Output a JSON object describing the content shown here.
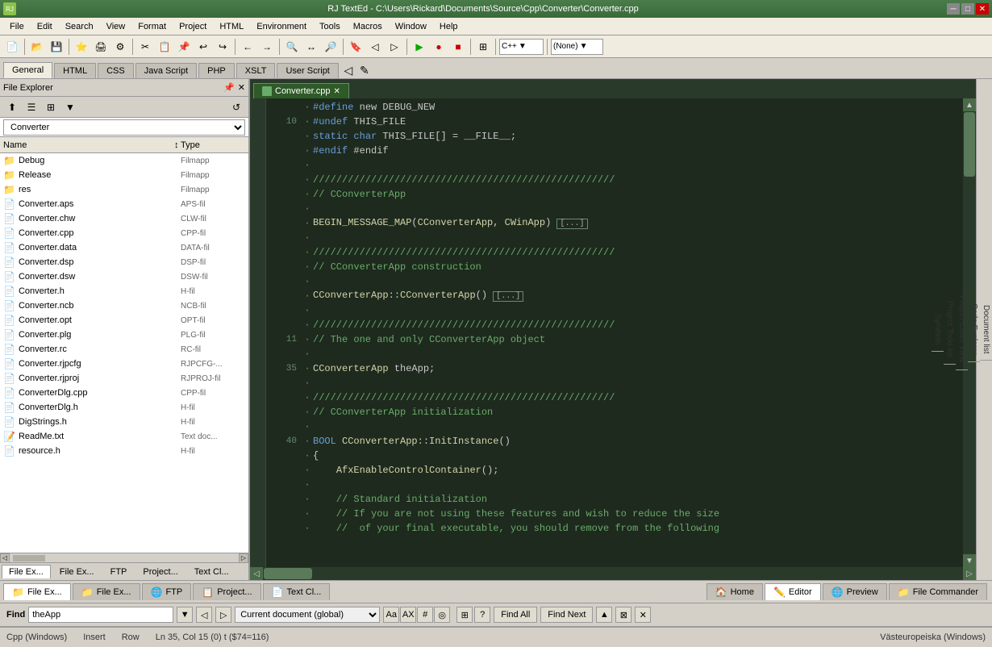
{
  "titlebar": {
    "title": "RJ TextEd - C:\\Users\\Rickard\\Documents\\Source\\Cpp\\Converter\\Converter.cpp",
    "app_icon": "RJ"
  },
  "menubar": {
    "items": [
      "File",
      "Edit",
      "Search",
      "View",
      "Format",
      "Project",
      "HTML",
      "Environment",
      "Tools",
      "Macros",
      "Window",
      "Help"
    ]
  },
  "tabs_top": {
    "items": [
      "General",
      "HTML",
      "CSS",
      "Java Script",
      "PHP",
      "XSLT",
      "User Script"
    ],
    "active": "General"
  },
  "file_explorer": {
    "title": "File Explorer",
    "folder": "Converter",
    "columns": {
      "name": "Name",
      "type": "Type"
    },
    "items": [
      {
        "name": "Debug",
        "type": "Filmapp",
        "icon": "folder"
      },
      {
        "name": "Release",
        "type": "Filmapp",
        "icon": "folder"
      },
      {
        "name": "res",
        "type": "Filmapp",
        "icon": "folder"
      },
      {
        "name": "Converter.aps",
        "type": "APS-fil",
        "icon": "file"
      },
      {
        "name": "Converter.chw",
        "type": "CLW-fil",
        "icon": "file"
      },
      {
        "name": "Converter.cpp",
        "type": "CPP-fil",
        "icon": "cpp"
      },
      {
        "name": "Converter.data",
        "type": "DATA-fil",
        "icon": "file"
      },
      {
        "name": "Converter.dsp",
        "type": "DSP-fil",
        "icon": "file"
      },
      {
        "name": "Converter.dsw",
        "type": "DSW-fil",
        "icon": "file"
      },
      {
        "name": "Converter.h",
        "type": "H-fil",
        "icon": "file"
      },
      {
        "name": "Converter.ncb",
        "type": "NCB-fil",
        "icon": "file"
      },
      {
        "name": "Converter.opt",
        "type": "OPT-fil",
        "icon": "file"
      },
      {
        "name": "Converter.plg",
        "type": "PLG-fil",
        "icon": "file"
      },
      {
        "name": "Converter.rc",
        "type": "RC-fil",
        "icon": "file"
      },
      {
        "name": "Converter.rjpcfg",
        "type": "RJPCFG-...",
        "icon": "file"
      },
      {
        "name": "Converter.rjproj",
        "type": "RJPROJ-fil",
        "icon": "file"
      },
      {
        "name": "ConverterDlg.cpp",
        "type": "CPP-fil",
        "icon": "cpp"
      },
      {
        "name": "ConverterDlg.h",
        "type": "H-fil",
        "icon": "file"
      },
      {
        "name": "DigStrings.h",
        "type": "H-fil",
        "icon": "file"
      },
      {
        "name": "ReadMe.txt",
        "type": "Text doc...",
        "icon": "txt"
      },
      {
        "name": "resource.h",
        "type": "H-fil",
        "icon": "file"
      }
    ]
  },
  "editor": {
    "tab_name": "Converter.cpp",
    "code_lines": [
      {
        "num": "",
        "dot": "·",
        "text": "#define new DEBUG_NEW",
        "type": "preprocessor"
      },
      {
        "num": "10",
        "dot": "·",
        "text": "#undef THIS_FILE",
        "type": "preprocessor"
      },
      {
        "num": "",
        "dot": "·",
        "text": "static char THIS_FILE[] = __FILE__;",
        "type": "code"
      },
      {
        "num": "",
        "dot": "·",
        "text": "#endif",
        "type": "preprocessor"
      },
      {
        "num": "",
        "dot": "·",
        "text": "",
        "type": "empty"
      },
      {
        "num": "",
        "dot": "·",
        "text": "////////////////////////////////////////////////////",
        "type": "comment_line"
      },
      {
        "num": "",
        "dot": "·",
        "text": "// CConverterApp",
        "type": "comment"
      },
      {
        "num": "",
        "dot": "·",
        "text": "",
        "type": "empty"
      },
      {
        "num": "",
        "dot": "·",
        "text": "BEGIN_MESSAGE_MAP(CConverterApp, CWinApp)",
        "type": "code",
        "fold": "[...]"
      },
      {
        "num": "",
        "dot": "·",
        "text": "",
        "type": "empty"
      },
      {
        "num": "",
        "dot": "·",
        "text": "////////////////////////////////////////////////////",
        "type": "comment_line"
      },
      {
        "num": "",
        "dot": "·",
        "text": "// CConverterApp construction",
        "type": "comment"
      },
      {
        "num": "",
        "dot": "·",
        "text": "",
        "type": "empty"
      },
      {
        "num": "",
        "dot": "·",
        "text": "CConverterApp::CConverterApp()",
        "type": "code",
        "fold": "[...]"
      },
      {
        "num": "",
        "dot": "·",
        "text": "",
        "type": "empty"
      },
      {
        "num": "",
        "dot": "·",
        "text": "////////////////////////////////////////////////////",
        "type": "comment_line"
      },
      {
        "num": "11",
        "dot": "·",
        "text": "// The one and only CConverterApp object",
        "type": "comment"
      },
      {
        "num": "",
        "dot": "·",
        "text": "",
        "type": "empty"
      },
      {
        "num": "35",
        "dot": "·",
        "text": "CConverterApp theApp;",
        "type": "code",
        "highlight": true
      },
      {
        "num": "",
        "dot": "·",
        "text": "",
        "type": "empty"
      },
      {
        "num": "",
        "dot": "·",
        "text": "////////////////////////////////////////////////////",
        "type": "comment_line"
      },
      {
        "num": "",
        "dot": "·",
        "text": "// CConverterApp initialization",
        "type": "comment"
      },
      {
        "num": "",
        "dot": "·",
        "text": "",
        "type": "empty"
      },
      {
        "num": "40",
        "dot": "·",
        "text": "BOOL CConverterApp::InitInstance()",
        "type": "code"
      },
      {
        "num": "",
        "dot": "·",
        "text": "{",
        "type": "code"
      },
      {
        "num": "",
        "dot": "·",
        "text": "    AfxEnableControlContainer();",
        "type": "code"
      },
      {
        "num": "",
        "dot": "·",
        "text": "",
        "type": "empty"
      },
      {
        "num": "",
        "dot": "·",
        "text": "    // Standard initialization",
        "type": "comment"
      },
      {
        "num": "",
        "dot": "·",
        "text": "    // If you are not using these features and wish to reduce the size",
        "type": "comment"
      },
      {
        "num": "",
        "dot": "·",
        "text": "    //  of your final executable, you should remove from the following",
        "type": "comment"
      }
    ]
  },
  "right_sidebar": {
    "items": [
      "Document list",
      "Code Explorer",
      "Project Class View",
      "Project Todo list",
      "Symbols"
    ]
  },
  "bottom_tabs": {
    "items": [
      {
        "label": "File Ex...",
        "icon": "📁"
      },
      {
        "label": "File Ex...",
        "icon": "📁"
      },
      {
        "label": "FTP",
        "icon": "🌐"
      },
      {
        "label": "Project...",
        "icon": "📋"
      },
      {
        "label": "Text Cl...",
        "icon": "📄"
      }
    ],
    "active": 0
  },
  "bottom_tabs2": {
    "items": [
      {
        "label": "Home",
        "icon": "🏠"
      },
      {
        "label": "Editor",
        "icon": "✏️"
      },
      {
        "label": "Preview",
        "icon": "🌐"
      },
      {
        "label": "File Commander",
        "icon": "📁"
      }
    ],
    "active": 1
  },
  "find_bar": {
    "label": "Find",
    "input_value": "theApp",
    "scope": "Current document (global)",
    "buttons": [
      "Find All",
      "Find Next"
    ],
    "options": [
      "Aa",
      "AX",
      "#",
      "◎"
    ]
  },
  "statusbar": {
    "lang": "Cpp (Windows)",
    "mode": "Insert",
    "unit": "Row",
    "position": "Ln 35, Col 15 (0) t ($74=116)",
    "encoding": "Västeuropeiska (Windows)"
  }
}
